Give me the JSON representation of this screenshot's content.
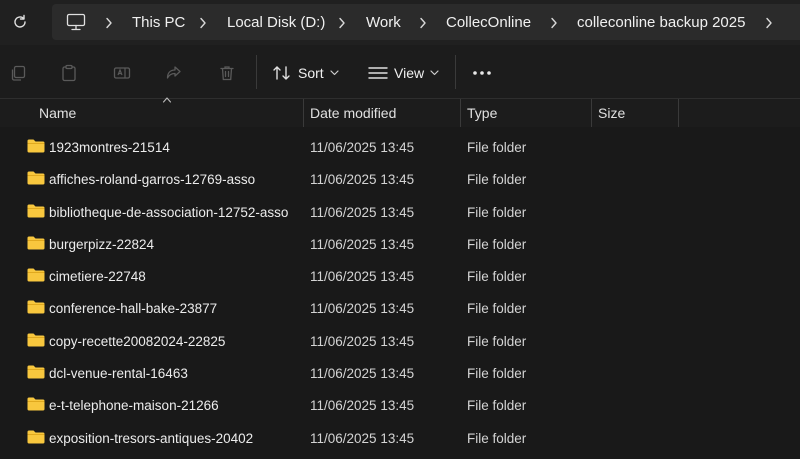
{
  "breadcrumb": {
    "items": [
      "This PC",
      "Local Disk (D:)",
      "Work",
      "CollecOnline",
      "colleconline backup 2025"
    ]
  },
  "toolbar": {
    "sort_label": "Sort",
    "view_label": "View"
  },
  "columns": {
    "name": "Name",
    "date_modified": "Date modified",
    "type": "Type",
    "size": "Size"
  },
  "files": [
    {
      "name": "1923montres-21514",
      "date": "11/06/2025 13:45",
      "type": "File folder"
    },
    {
      "name": "affiches-roland-garros-12769-asso",
      "date": "11/06/2025 13:45",
      "type": "File folder"
    },
    {
      "name": "bibliotheque-de-association-12752-asso",
      "date": "11/06/2025 13:45",
      "type": "File folder"
    },
    {
      "name": "burgerpizz-22824",
      "date": "11/06/2025 13:45",
      "type": "File folder"
    },
    {
      "name": "cimetiere-22748",
      "date": "11/06/2025 13:45",
      "type": "File folder"
    },
    {
      "name": "conference-hall-bake-23877",
      "date": "11/06/2025 13:45",
      "type": "File folder"
    },
    {
      "name": "copy-recette20082024-22825",
      "date": "11/06/2025 13:45",
      "type": "File folder"
    },
    {
      "name": "dcl-venue-rental-16463",
      "date": "11/06/2025 13:45",
      "type": "File folder"
    },
    {
      "name": "e-t-telephone-maison-21266",
      "date": "11/06/2025 13:45",
      "type": "File folder"
    },
    {
      "name": "exposition-tresors-antiques-20402",
      "date": "11/06/2025 13:45",
      "type": "File folder"
    }
  ],
  "colors": {
    "background": "#191919",
    "folder_yellow": "#f8c73e",
    "folder_shade": "#e0a91f"
  }
}
